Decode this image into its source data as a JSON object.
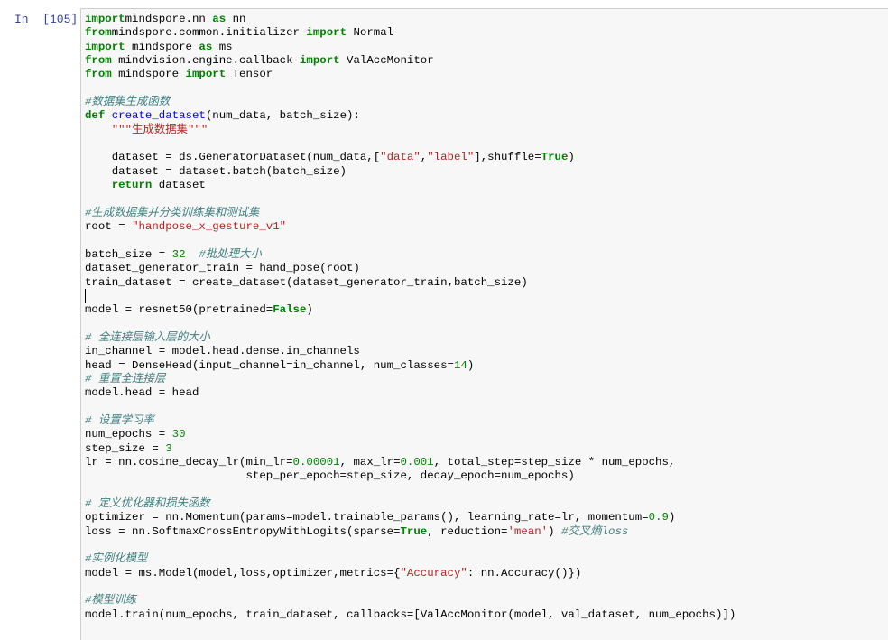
{
  "cell": {
    "prompt": "In  [105]:",
    "lines": [
      [
        [
          "kw",
          "import"
        ],
        [
          "",
          "mindspore.nn "
        ],
        [
          "kw",
          "as"
        ],
        [
          "",
          " nn"
        ]
      ],
      [
        [
          "kw",
          "from"
        ],
        [
          "",
          "mindspore.common.initializer "
        ],
        [
          "kw",
          "import"
        ],
        [
          "",
          " Normal"
        ]
      ],
      [
        [
          "kw",
          "import"
        ],
        [
          "",
          " mindspore "
        ],
        [
          "kw",
          "as"
        ],
        [
          "",
          " ms"
        ]
      ],
      [
        [
          "kw",
          "from"
        ],
        [
          "",
          " mindvision.engine.callback "
        ],
        [
          "kw",
          "import"
        ],
        [
          "",
          " ValAccMonitor"
        ]
      ],
      [
        [
          "kw",
          "from"
        ],
        [
          "",
          " mindspore "
        ],
        [
          "kw",
          "import"
        ],
        [
          "",
          " Tensor"
        ]
      ],
      [],
      [
        [
          "cm",
          "#数据集生成函数"
        ]
      ],
      [
        [
          "kw",
          "def"
        ],
        [
          "",
          " "
        ],
        [
          "fn",
          "create_dataset"
        ],
        [
          "",
          "(num_data, batch_size):"
        ]
      ],
      [
        [
          "",
          "    "
        ],
        [
          "str",
          "\"\"\"生成数据集\"\"\""
        ]
      ],
      [],
      [
        [
          "",
          "    dataset = ds.GeneratorDataset(num_data,["
        ],
        [
          "str",
          "\"data\""
        ],
        [
          "",
          ","
        ],
        [
          "str",
          "\"label\""
        ],
        [
          "",
          "],shuffle="
        ],
        [
          "kw",
          "True"
        ],
        [
          "",
          ")"
        ]
      ],
      [
        [
          "",
          "    dataset = dataset.batch(batch_size)"
        ]
      ],
      [
        [
          "",
          "    "
        ],
        [
          "kw",
          "return"
        ],
        [
          "",
          " dataset"
        ]
      ],
      [],
      [
        [
          "cm",
          "#生成数据集并分类训练集和测试集"
        ]
      ],
      [
        [
          "",
          "root = "
        ],
        [
          "str",
          "\"handpose_x_gesture_v1\""
        ]
      ],
      [],
      [
        [
          "",
          "batch_size = "
        ],
        [
          "num",
          "32"
        ],
        [
          "",
          "  "
        ],
        [
          "cm",
          "#批处理大小"
        ]
      ],
      [
        [
          "",
          "dataset_generator_train = hand_pose(root)"
        ]
      ],
      [
        [
          "",
          "train_dataset = create_dataset(dataset_generator_train,batch_size)"
        ]
      ],
      [],
      [
        [
          "",
          "model = resnet50(pretrained="
        ],
        [
          "kw",
          "False"
        ],
        [
          "",
          ")"
        ]
      ],
      [],
      [
        [
          "cm",
          "# 全连接层输入层的大小"
        ]
      ],
      [
        [
          "",
          "in_channel = model.head.dense.in_channels"
        ]
      ],
      [
        [
          "",
          "head = DenseHead(input_channel=in_channel, num_classes="
        ],
        [
          "num",
          "14"
        ],
        [
          "",
          ")"
        ]
      ],
      [
        [
          "cm",
          "# 重置全连接层"
        ]
      ],
      [
        [
          "",
          "model.head = head"
        ]
      ],
      [],
      [
        [
          "cm",
          "# 设置学习率"
        ]
      ],
      [
        [
          "",
          "num_epochs = "
        ],
        [
          "num",
          "30"
        ]
      ],
      [
        [
          "",
          "step_size = "
        ],
        [
          "num",
          "3"
        ]
      ],
      [
        [
          "",
          "lr = nn.cosine_decay_lr(min_lr="
        ],
        [
          "num",
          "0.00001"
        ],
        [
          "",
          ", max_lr="
        ],
        [
          "num",
          "0.001"
        ],
        [
          "",
          ", total_step=step_size * num_epochs,"
        ]
      ],
      [
        [
          "",
          "                        step_per_epoch=step_size, decay_epoch=num_epochs)"
        ]
      ],
      [],
      [
        [
          "cm",
          "# 定义优化器和损失函数"
        ]
      ],
      [
        [
          "",
          "optimizer = nn.Momentum(params=model.trainable_params(), learning_rate=lr, momentum="
        ],
        [
          "num",
          "0.9"
        ],
        [
          "",
          ")"
        ]
      ],
      [
        [
          "",
          "loss = nn.SoftmaxCrossEntropyWithLogits(sparse="
        ],
        [
          "kw",
          "True"
        ],
        [
          "",
          ", reduction="
        ],
        [
          "str",
          "'mean'"
        ],
        [
          "",
          ") "
        ],
        [
          "cm",
          "#交叉熵loss"
        ]
      ],
      [],
      [
        [
          "cm",
          "#实例化模型"
        ]
      ],
      [
        [
          "",
          "model = ms.Model(model,loss,optimizer,metrics={"
        ],
        [
          "str",
          "\"Accuracy\""
        ],
        [
          "",
          ": nn.Accuracy()})"
        ]
      ],
      [],
      [
        [
          "cm",
          "#模型训练"
        ]
      ],
      [
        [
          "",
          "model.train(num_epochs, train_dataset, callbacks=[ValAccMonitor(model, val_dataset, num_epochs)])"
        ]
      ]
    ]
  }
}
